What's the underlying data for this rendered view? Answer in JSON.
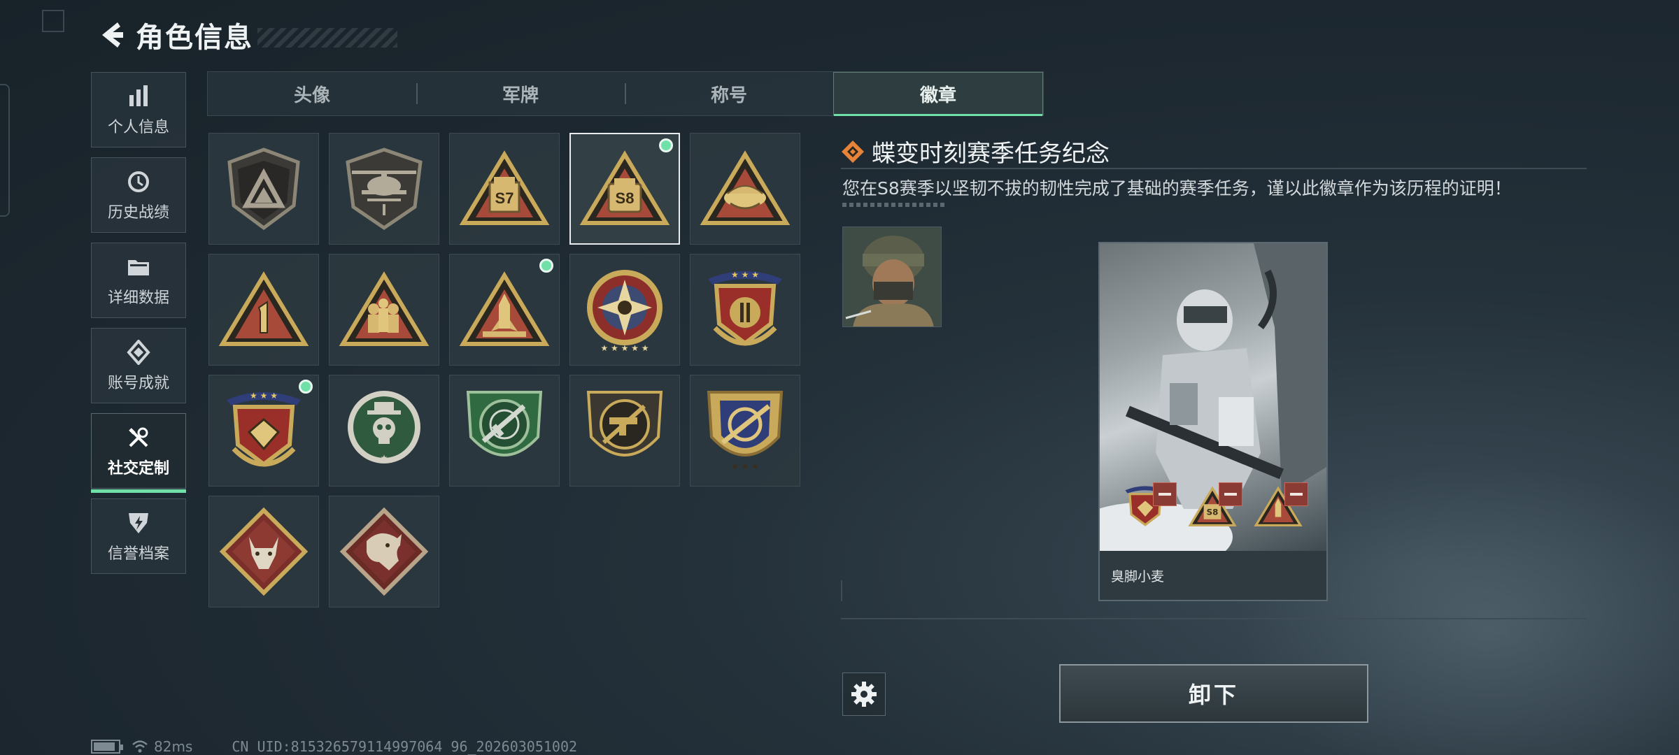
{
  "header": {
    "title": "角色信息"
  },
  "sidebar": {
    "items": [
      {
        "label": "个人信息",
        "icon": "bar-chart-icon"
      },
      {
        "label": "历史战绩",
        "icon": "history-icon"
      },
      {
        "label": "详细数据",
        "icon": "folder-icon"
      },
      {
        "label": "账号成就",
        "icon": "achievement-icon"
      },
      {
        "label": "社交定制",
        "icon": "wrench-icon",
        "active": true
      },
      {
        "label": "信誉档案",
        "icon": "credit-shield-icon"
      }
    ]
  },
  "tabs": [
    {
      "label": "头像"
    },
    {
      "label": "军牌"
    },
    {
      "label": "称号"
    },
    {
      "label": "徽章",
      "active": true
    }
  ],
  "badges": [
    {
      "badge_label": "S7",
      "equipped": false
    },
    {
      "badge_label": "S8",
      "equipped": true,
      "selected": true
    }
  ],
  "detail": {
    "title": "蝶变时刻赛季任务纪念",
    "description": "您在S8赛季以坚韧不拔的韧性完成了基础的赛季任务，谨以此徽章作为该历程的证明！",
    "player_name": "臭脚小麦",
    "unequip_label": "卸下"
  },
  "status": {
    "ping": "82ms",
    "uid": "CN UID:815326579114997064 96_202603051002"
  },
  "colors": {
    "accent": "#6fe0a8",
    "gold": "#c9a95a",
    "badge_dark": "#2a2620",
    "red": "#8a3b33"
  }
}
